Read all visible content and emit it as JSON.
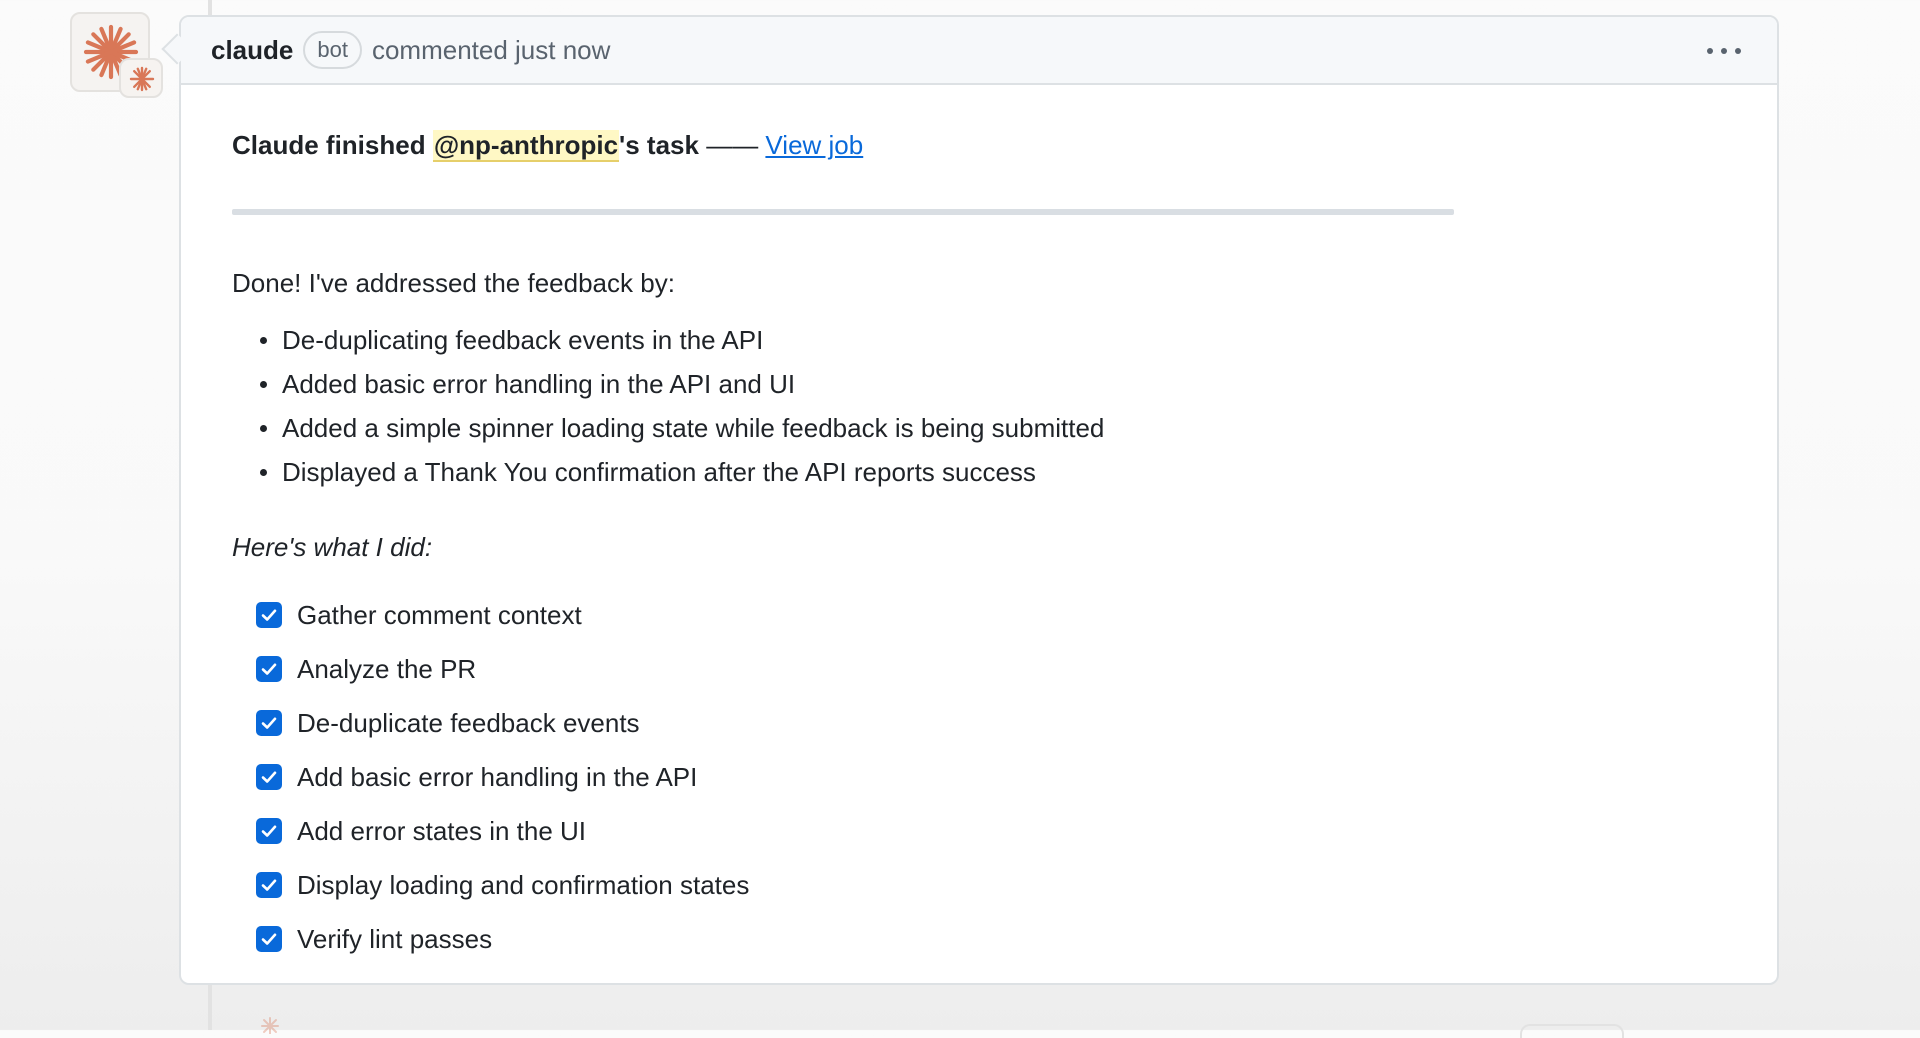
{
  "comment": {
    "author": "claude",
    "author_badge": "bot",
    "meta": "commented just now",
    "more_icon": "kebab-horizontal-icon",
    "avatar_icon": "anthropic-starburst-icon",
    "task_line": {
      "prefix": "Claude finished ",
      "mention": "@np-anthropic",
      "suffix": "'s task",
      "separator": "——",
      "link": "View job"
    },
    "intro": "Done! I've addressed the feedback by:",
    "bullets": [
      "De-duplicating feedback events in the API",
      "Added basic error handling in the API and UI",
      "Added a simple spinner loading state while feedback is being submitted",
      "Displayed a Thank You confirmation after the API reports success"
    ],
    "checklist_heading": "Here's what I did:",
    "checklist": [
      {
        "label": "Gather comment context",
        "checked": true
      },
      {
        "label": "Analyze the PR",
        "checked": true
      },
      {
        "label": "De-duplicate feedback events",
        "checked": true
      },
      {
        "label": "Add basic error handling in the API",
        "checked": true
      },
      {
        "label": "Add error states in the UI",
        "checked": true
      },
      {
        "label": "Display loading and confirmation states",
        "checked": true
      },
      {
        "label": "Verify lint passes",
        "checked": true
      }
    ]
  },
  "colors": {
    "accent_link": "#0969da",
    "mention_highlight": "#fff8c5",
    "avatar_orange": "#d97757"
  }
}
